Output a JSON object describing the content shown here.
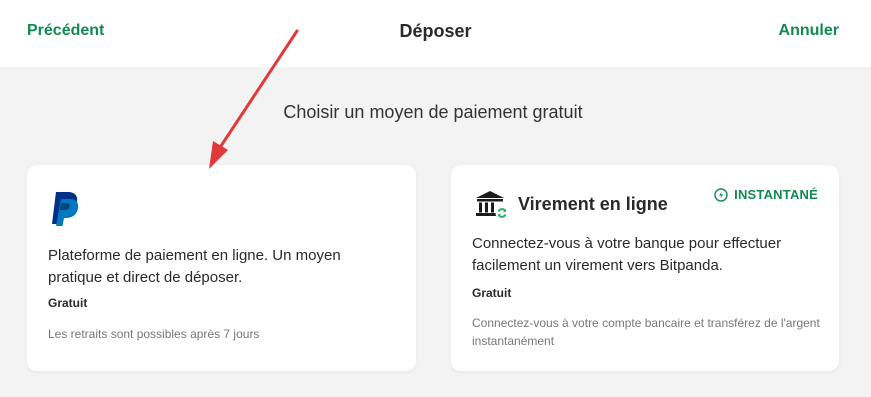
{
  "header": {
    "back_label": "Précédent",
    "title": "Déposer",
    "cancel_label": "Annuler"
  },
  "subtitle": "Choisir un moyen de paiement gratuit",
  "methods": [
    {
      "icon": "paypal-logo",
      "description": "Plateforme de paiement en ligne. Un moyen pratique et direct de déposer.",
      "fee": "Gratuit",
      "note": "Les retraits sont possibles après 7 jours"
    },
    {
      "icon": "bank-icon",
      "name": "Virement en ligne",
      "badge": "INSTANTANÉ",
      "badge_icon": "instant-clock-icon",
      "description": "Connectez-vous à votre banque pour effectuer facilement un virement vers Bitpanda.",
      "fee": "Gratuit",
      "note": "Connectez-vous à votre compte bancaire et transférez de l'argent instantanément"
    }
  ],
  "colors": {
    "accent_green": "#138a52",
    "annotation_red": "#e0393a",
    "page_background": "#f3f3f3"
  }
}
